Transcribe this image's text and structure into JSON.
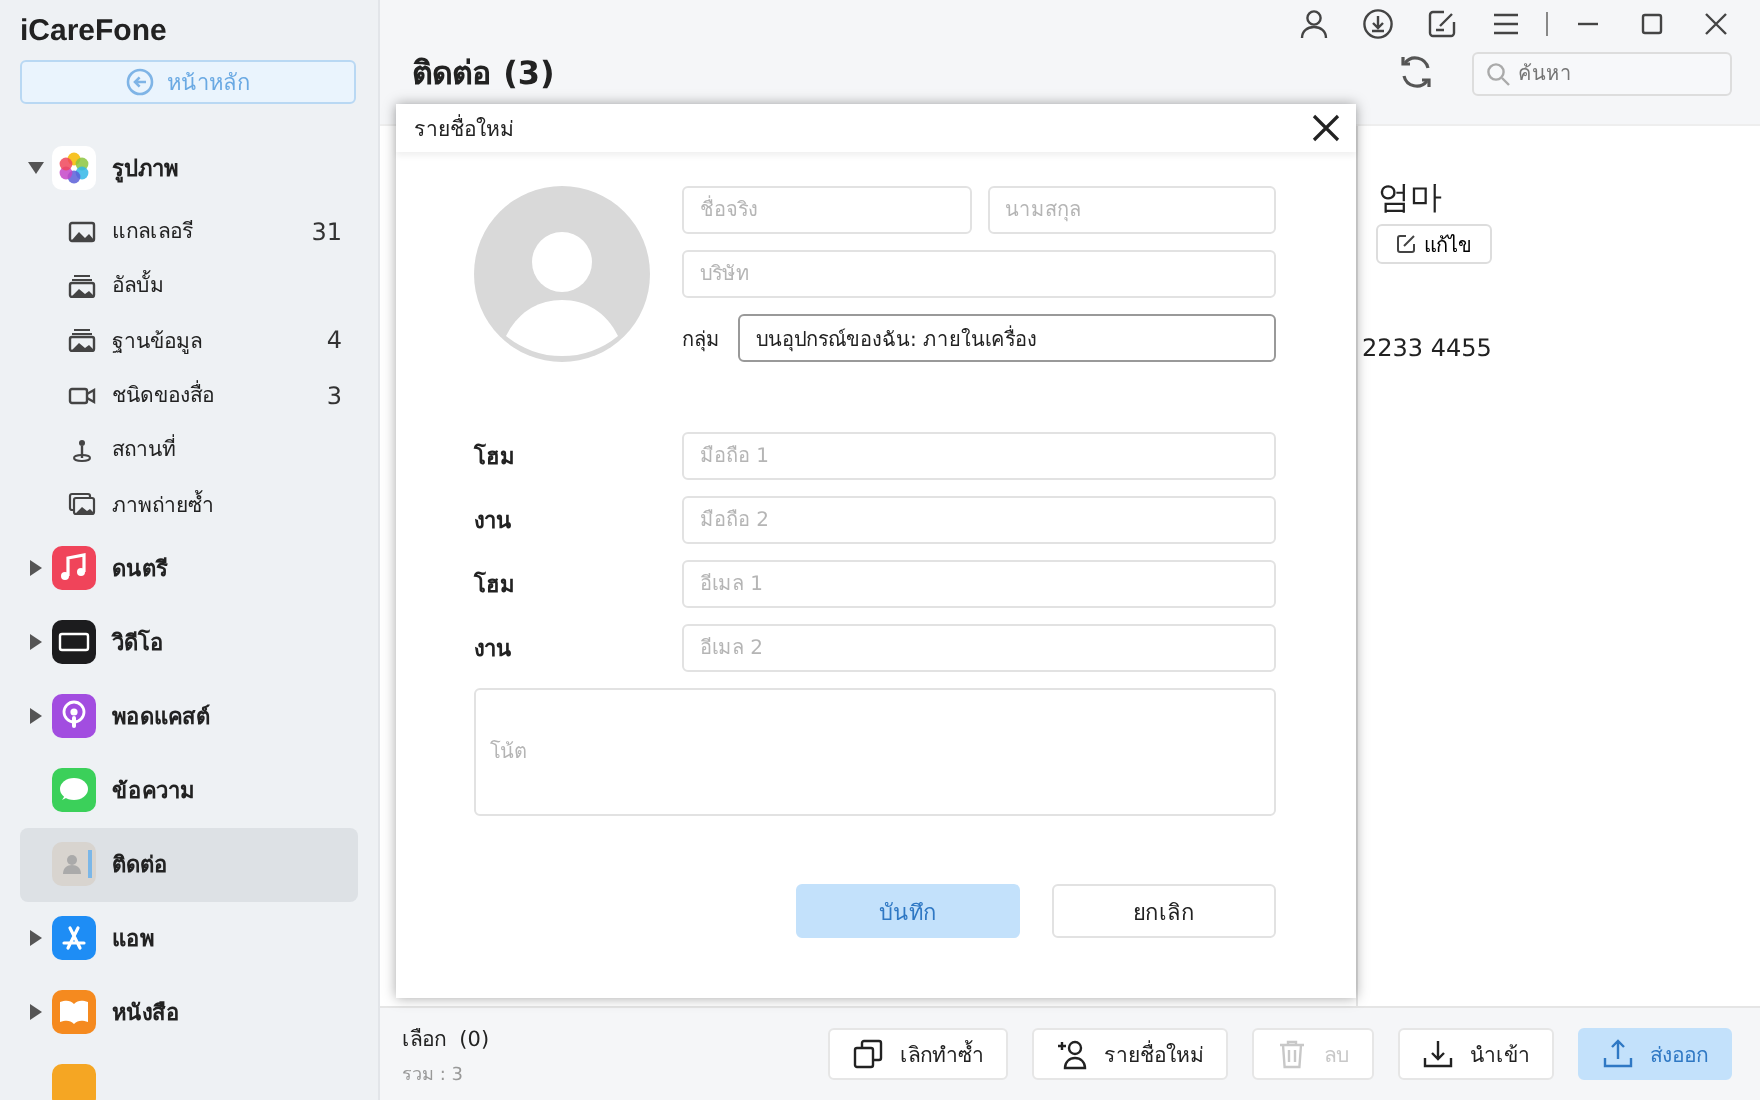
{
  "app_name": "iCareFone",
  "home_button": {
    "label": "หน้าหลัก"
  },
  "sidebar": {
    "items": [
      {
        "label": "รูปภาพ",
        "kind": "photos",
        "expanded": true,
        "selected": false,
        "children": [
          {
            "label": "แกลเลอรี",
            "kind": "gallery",
            "count": "31"
          },
          {
            "label": "อัลบั้ม",
            "kind": "album"
          },
          {
            "label": "ฐานข้อมูล",
            "kind": "album",
            "count": "4"
          },
          {
            "label": "ชนิดของสื่อ",
            "kind": "video",
            "count": "3"
          },
          {
            "label": "สถานที่",
            "kind": "pin"
          },
          {
            "label": "ภาพถ่ายซ้ำ",
            "kind": "burst"
          }
        ]
      },
      {
        "label": "ดนตรี",
        "kind": "music",
        "expanded": false,
        "selected": false
      },
      {
        "label": "วิดีโอ",
        "kind": "tv",
        "expanded": false,
        "selected": false
      },
      {
        "label": "พอดแคสต์",
        "kind": "podcasts",
        "expanded": false,
        "selected": false
      },
      {
        "label": "ข้อความ",
        "kind": "messages",
        "selected": false
      },
      {
        "label": "ติดต่อ",
        "kind": "contacts",
        "selected": true
      },
      {
        "label": "แอพ",
        "kind": "appstore",
        "expanded": false,
        "selected": false
      },
      {
        "label": "หนังสือ",
        "kind": "books",
        "expanded": false,
        "selected": false
      }
    ]
  },
  "header": {
    "title": "ติดต่อ (3)",
    "search": {
      "placeholder": "ค้นหา"
    }
  },
  "detail": {
    "name": "엄마",
    "edit_button": "แก้ไข",
    "phone": "2233 4455"
  },
  "footer": {
    "selected": "เลือก  (0)",
    "total": "รวม : 3",
    "buttons": [
      {
        "label": "เลิกทำซ้ำ",
        "kind": "copy",
        "disabled": false,
        "primary": false
      },
      {
        "label": "รายชื่อใหม่",
        "kind": "person-add",
        "disabled": false,
        "primary": false
      },
      {
        "label": "ลบ",
        "kind": "trash",
        "disabled": true,
        "primary": false
      },
      {
        "label": "นำเข้า",
        "kind": "import",
        "disabled": false,
        "primary": false
      },
      {
        "label": "ส่งออก",
        "kind": "export",
        "disabled": true,
        "primary": true
      }
    ]
  },
  "dialog": {
    "title": "รายชื่อใหม่",
    "first_name": {
      "placeholder": "ชื่อจริง"
    },
    "last_name": {
      "placeholder": "นามสกุล"
    },
    "company": {
      "placeholder": "บริษัท"
    },
    "group": {
      "label": "กลุ่ม",
      "value": "บนอุปกรณ์ของฉัน: ภายในเครื่อง"
    },
    "rows": [
      {
        "label": "โฮม",
        "placeholder": "มือถือ 1"
      },
      {
        "label": "งาน",
        "placeholder": "มือถือ 2"
      },
      {
        "label": "โฮม",
        "placeholder": "อีเมล 1"
      },
      {
        "label": "งาน",
        "placeholder": "อีเมล 2"
      }
    ],
    "note": {
      "placeholder": "โน้ต"
    },
    "buttons": [
      {
        "label": "บันทึก",
        "primary": true,
        "disabled": true
      },
      {
        "label": "ยกเลิก",
        "primary": false,
        "disabled": false
      }
    ]
  }
}
